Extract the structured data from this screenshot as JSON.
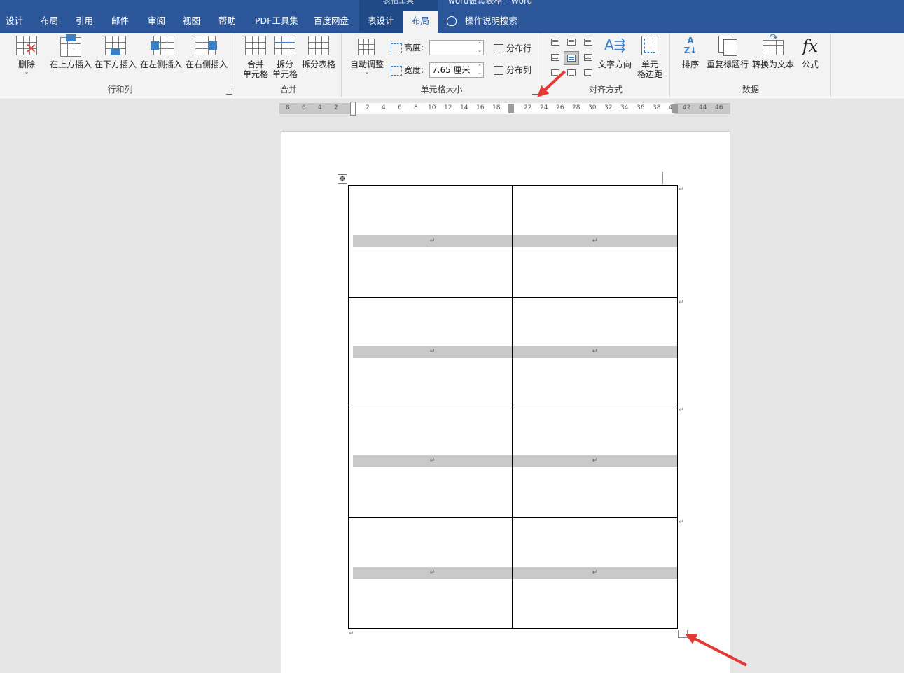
{
  "title_bar": {
    "context_title": "表格工具",
    "doc_title": "word做套表格 - Word"
  },
  "tabs": [
    "设计",
    "布局",
    "引用",
    "邮件",
    "审阅",
    "视图",
    "帮助",
    "PDF工具集",
    "百度网盘",
    "表设计",
    "布局"
  ],
  "active_tab": "布局",
  "tell_me": "操作说明搜索",
  "ribbon": {
    "rows_cols": {
      "label": "行和列",
      "delete": "删除",
      "insert_above": "在上方插入",
      "insert_below": "在下方插入",
      "insert_left": "在左侧插入",
      "insert_right": "在右侧插入"
    },
    "merge": {
      "label": "合并",
      "merge_cells_1": "合并",
      "merge_cells_2": "单元格",
      "split_cells_1": "拆分",
      "split_cells_2": "单元格",
      "split_table": "拆分表格"
    },
    "cell_size": {
      "label": "单元格大小",
      "autofit": "自动调整",
      "height_label": "高度:",
      "height_value": "",
      "width_label": "宽度:",
      "width_value": "7.65 厘米",
      "distribute_rows": "分布行",
      "distribute_cols": "分布列"
    },
    "alignment": {
      "label": "对齐方式",
      "text_direction": "文字方向",
      "cell_margins_1": "单元",
      "cell_margins_2": "格边距",
      "selected": "middle-center"
    },
    "data": {
      "label": "数据",
      "sort": "排序",
      "repeat_header": "重复标题行",
      "convert_to_text": "转换为文本",
      "formula": "公式"
    }
  },
  "ruler": {
    "left": [
      "8",
      "6",
      "4",
      "2"
    ],
    "right": [
      "2",
      "4",
      "6",
      "8",
      "10",
      "12",
      "14",
      "16",
      "18",
      "22",
      "24",
      "26",
      "28",
      "30",
      "32",
      "34",
      "36",
      "38",
      "40",
      "42",
      "44",
      "46"
    ]
  },
  "table": {
    "rows": 4,
    "cols": 2,
    "para_mark": "↵"
  },
  "colors": {
    "accent": "#2b579a",
    "arrow": "#e53935"
  }
}
